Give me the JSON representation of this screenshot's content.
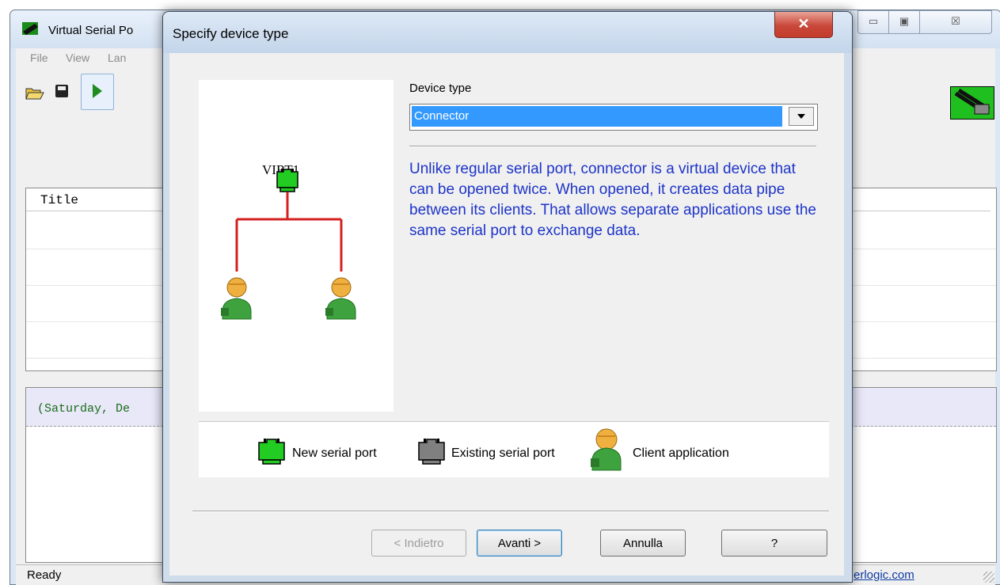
{
  "main_window": {
    "title": "Virtual Serial Po",
    "menu": [
      "File",
      "View",
      "Lan"
    ],
    "caption_buttons": {
      "minimize": "▭",
      "maximize": "▣",
      "close": "☒"
    },
    "list": {
      "column_title": "Title"
    },
    "log": {
      "first_line": "(Saturday, De"
    },
    "status": {
      "text": "Ready",
      "link": "erlogic.com"
    }
  },
  "dialog": {
    "title": "Specify device type",
    "close_glyph": "✕",
    "diagram": {
      "node_label": "VIRT1"
    },
    "device_type": {
      "label": "Device type",
      "selected": "Connector"
    },
    "description": "Unlike regular serial port, connector is a virtual device that can be opened twice. When opened, it creates data pipe between its clients. That allows separate applications use the same serial port to exchange data.",
    "legend": {
      "new_port": "New serial port",
      "existing_port": "Existing serial port",
      "client_app": "Client application"
    },
    "buttons": {
      "back": "< Indietro",
      "next": "Avanti >",
      "cancel": "Annulla",
      "help": "?"
    }
  },
  "colors": {
    "new_port": "#22cc22",
    "existing_port": "#808080",
    "wire": "#d42020",
    "description_text": "#1d34c8",
    "selection": "#3399ff"
  }
}
